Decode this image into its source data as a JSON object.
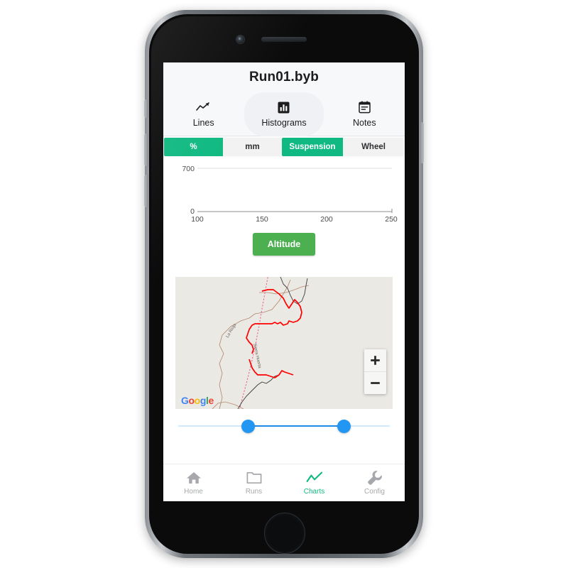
{
  "app": {
    "title": "Run01.byb"
  },
  "top_tabs": [
    {
      "label": "Lines",
      "icon": "line-chart-icon",
      "active": false
    },
    {
      "label": "Histograms",
      "icon": "bar-chart-icon",
      "active": false
    },
    {
      "label": "Notes",
      "icon": "notes-icon",
      "active": false
    }
  ],
  "segmented": {
    "units": {
      "options": [
        "%",
        "mm"
      ],
      "selected": "%"
    },
    "source": {
      "options": [
        "Suspension",
        "Wheel"
      ],
      "selected": "Suspension"
    }
  },
  "chart_data": {
    "type": "line",
    "title": "",
    "xlabel": "",
    "ylabel": "",
    "x": [],
    "values": [],
    "series": [
      {
        "name": "Altitude",
        "values": []
      }
    ],
    "xlim": [
      100,
      250
    ],
    "ylim": [
      0,
      700
    ],
    "x_ticks": [
      "100",
      "150",
      "200",
      "250"
    ],
    "y_ticks": [
      "0",
      "700"
    ],
    "grid": true,
    "legend": "none"
  },
  "altitude_button": {
    "label": "Altitude",
    "color": "#4caf50"
  },
  "map": {
    "provider_logo": "Google",
    "road_labels": [
      "La Rioja",
      "Sierra Huerta"
    ],
    "track_color": "#ff0000",
    "background_color": "#eae9e4",
    "zoom_in_label": "+",
    "zoom_out_label": "−"
  },
  "range_slider": {
    "min_handle_label": "",
    "max_handle_label": "",
    "accent": "#2196f3"
  },
  "bottom_nav": [
    {
      "label": "Home",
      "icon": "home-icon",
      "active": false
    },
    {
      "label": "Runs",
      "icon": "folder-icon",
      "active": false
    },
    {
      "label": "Charts",
      "icon": "line-chart-icon",
      "active": true
    },
    {
      "label": "Config",
      "icon": "wrench-icon",
      "active": false
    }
  ],
  "theme": {
    "accent_green": "#10b981",
    "altitude_green": "#4caf50",
    "slider_blue": "#2196f3"
  }
}
